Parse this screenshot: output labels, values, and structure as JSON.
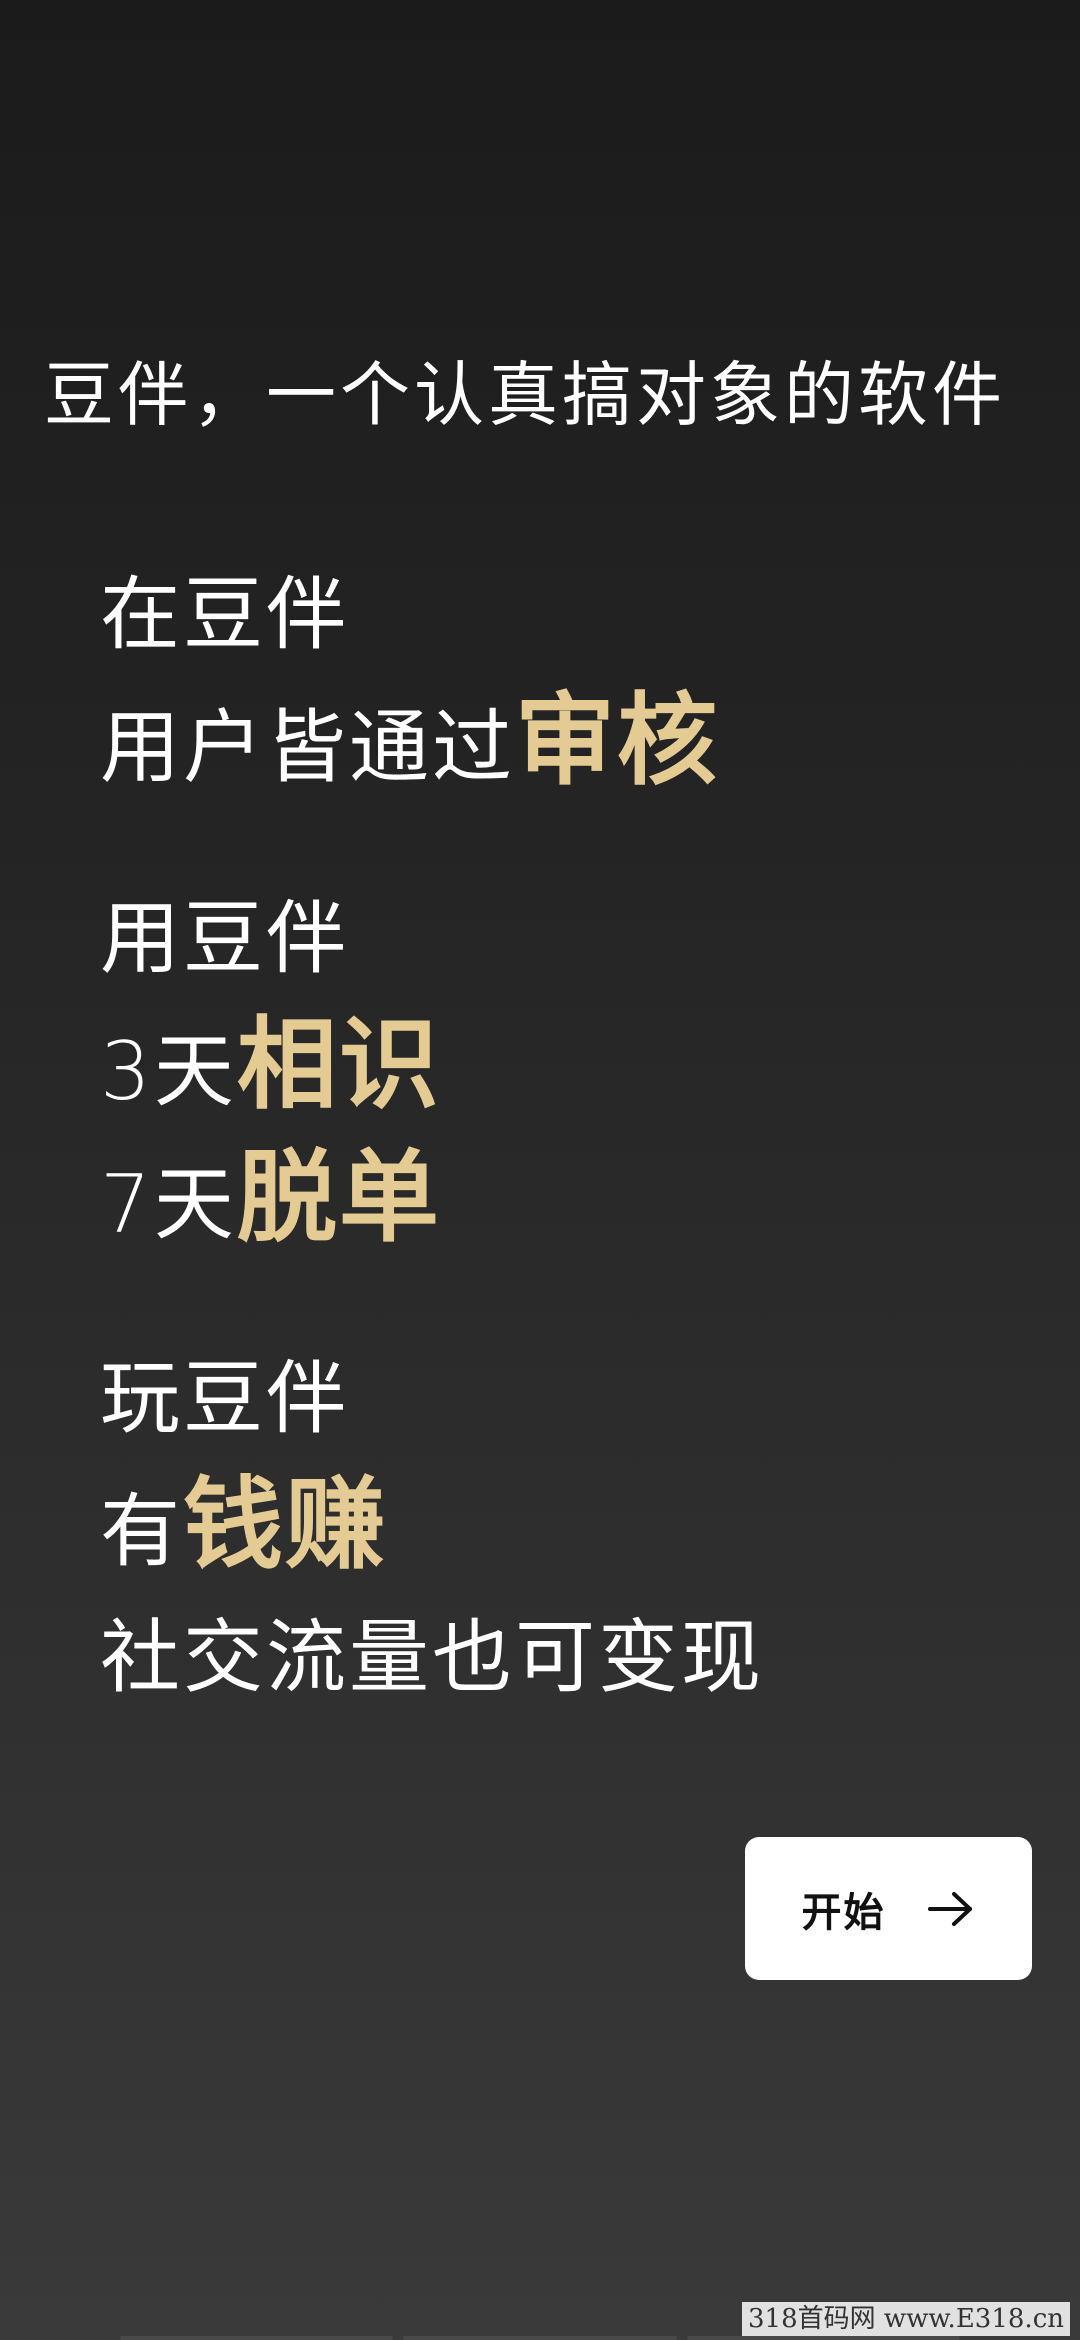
{
  "tagline": "豆伴，一个认真搞对象的软件",
  "blocks": [
    {
      "line1": "在豆伴",
      "line2_prefix": "用户皆通过",
      "line2_highlight": "审核"
    },
    {
      "line1": "用豆伴",
      "line2_prefix": "3天",
      "line2_highlight": "相识",
      "line3_prefix": "7天",
      "line3_highlight": "脱单"
    },
    {
      "line1": "玩豆伴",
      "line2_prefix": "有",
      "line2_highlight": "钱赚",
      "line3": "社交流量也可变现"
    }
  ],
  "start_button": {
    "label": "开始",
    "icon": "arrow-right-icon"
  },
  "watermark": "318首码网 www.E318.cn",
  "colors": {
    "highlight": "#e4cb94",
    "background_top": "#1b1b1b",
    "background_bottom": "#3a3a3a",
    "button_bg": "#ffffff"
  }
}
